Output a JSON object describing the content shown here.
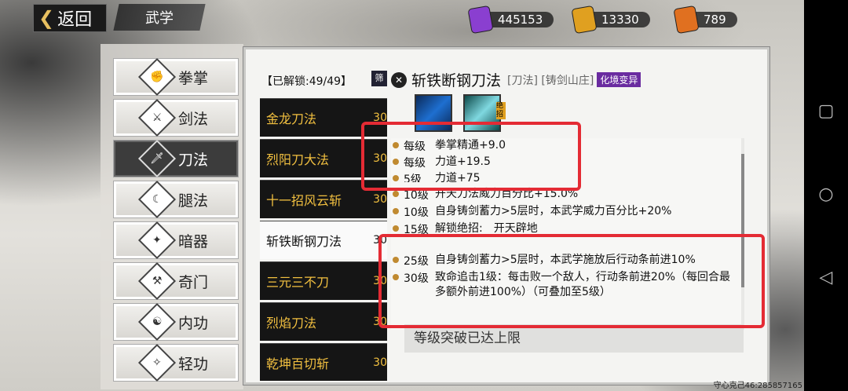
{
  "topbar": {
    "back_label": "返回",
    "section_title": "武学",
    "currencies": [
      {
        "icon": "purple-scroll-icon",
        "value": "445153",
        "color": "#8a3fd0"
      },
      {
        "icon": "gold-scroll-icon",
        "value": "13330",
        "color": "#e0a020"
      },
      {
        "icon": "orange-scroll-icon",
        "value": "789",
        "color": "#e07020"
      }
    ]
  },
  "categories": [
    {
      "label": "拳掌",
      "icon": "fist-icon"
    },
    {
      "label": "剑法",
      "icon": "sword-icon"
    },
    {
      "label": "刀法",
      "icon": "blade-icon",
      "selected": true
    },
    {
      "label": "腿法",
      "icon": "leg-icon"
    },
    {
      "label": "暗器",
      "icon": "dart-icon"
    },
    {
      "label": "奇门",
      "icon": "odd-weapon-icon"
    },
    {
      "label": "内功",
      "icon": "inner-power-icon"
    },
    {
      "label": "轻功",
      "icon": "light-skill-icon"
    }
  ],
  "list": {
    "unlock_label": "【已解锁:49/49】",
    "filter_label": "筛",
    "skills": [
      {
        "name": "金龙刀法",
        "level": "30"
      },
      {
        "name": "烈阳刀大法",
        "level": "30"
      },
      {
        "name": "十一招风云斩",
        "level": "30"
      },
      {
        "name": "斩铁断钢刀法",
        "level": "30",
        "selected": true
      },
      {
        "name": "三元三不刀",
        "level": "30"
      },
      {
        "name": "烈焰刀法",
        "level": "30"
      },
      {
        "name": "乾坤百切斩",
        "level": "30"
      }
    ]
  },
  "detail": {
    "title": "斩铁断钢刀法",
    "tags": "[刀法] [铸剑山庄]",
    "badge": "化境变异",
    "skill_icons": [
      "blade-slash-icon",
      "ultimate-icon"
    ],
    "ultimate_mark": "绝招",
    "effects": [
      {
        "level": "每级",
        "text": "拳掌精通+9.0"
      },
      {
        "level": "每级",
        "text": "力道+19.5"
      },
      {
        "level": "5级",
        "text": "力道+75"
      },
      {
        "level": "10级",
        "text": "开天刀法威力百分比+15.0%"
      },
      {
        "level": "10级",
        "text": "自身铸剑蓄力>5层时，本武学威力百分比+20%"
      },
      {
        "level": "15级",
        "text": "解锁绝招:　开天辟地"
      },
      {
        "level": "25级",
        "text": "自身铸剑蓄力>5层时，本武学施放后行动条前进10%"
      },
      {
        "level": "30级",
        "text": "致命追击1级：每击败一个敌人，行动条前进20%（每回合最多额外前进100%）（可叠加至5级）"
      }
    ],
    "max_label": "等级突破已达上限"
  },
  "watermark": "守心克己46:285857165",
  "colors": {
    "highlight_box": "#e42b34",
    "skill_gold": "#f2c040",
    "badge": "#6a2ca0"
  }
}
